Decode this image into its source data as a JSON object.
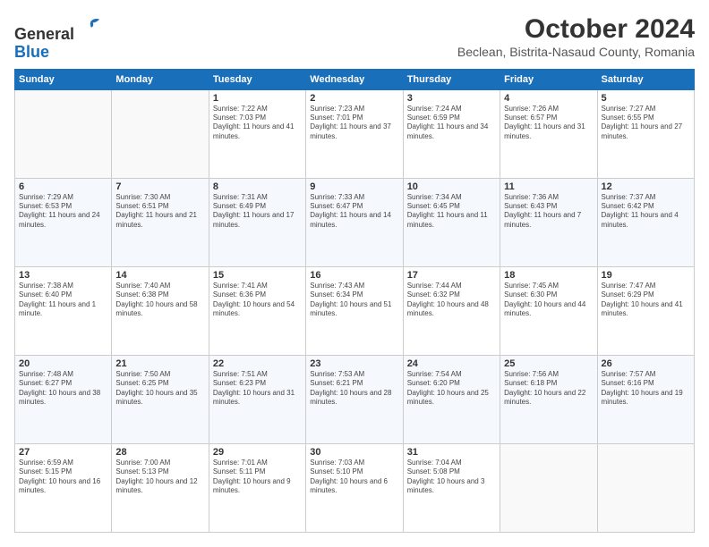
{
  "header": {
    "logo_line1": "General",
    "logo_line2": "Blue",
    "month": "October 2024",
    "location": "Beclean, Bistrita-Nasaud County, Romania"
  },
  "days_of_week": [
    "Sunday",
    "Monday",
    "Tuesday",
    "Wednesday",
    "Thursday",
    "Friday",
    "Saturday"
  ],
  "weeks": [
    [
      {
        "day": "",
        "info": ""
      },
      {
        "day": "",
        "info": ""
      },
      {
        "day": "1",
        "info": "Sunrise: 7:22 AM\nSunset: 7:03 PM\nDaylight: 11 hours and 41 minutes."
      },
      {
        "day": "2",
        "info": "Sunrise: 7:23 AM\nSunset: 7:01 PM\nDaylight: 11 hours and 37 minutes."
      },
      {
        "day": "3",
        "info": "Sunrise: 7:24 AM\nSunset: 6:59 PM\nDaylight: 11 hours and 34 minutes."
      },
      {
        "day": "4",
        "info": "Sunrise: 7:26 AM\nSunset: 6:57 PM\nDaylight: 11 hours and 31 minutes."
      },
      {
        "day": "5",
        "info": "Sunrise: 7:27 AM\nSunset: 6:55 PM\nDaylight: 11 hours and 27 minutes."
      }
    ],
    [
      {
        "day": "6",
        "info": "Sunrise: 7:29 AM\nSunset: 6:53 PM\nDaylight: 11 hours and 24 minutes."
      },
      {
        "day": "7",
        "info": "Sunrise: 7:30 AM\nSunset: 6:51 PM\nDaylight: 11 hours and 21 minutes."
      },
      {
        "day": "8",
        "info": "Sunrise: 7:31 AM\nSunset: 6:49 PM\nDaylight: 11 hours and 17 minutes."
      },
      {
        "day": "9",
        "info": "Sunrise: 7:33 AM\nSunset: 6:47 PM\nDaylight: 11 hours and 14 minutes."
      },
      {
        "day": "10",
        "info": "Sunrise: 7:34 AM\nSunset: 6:45 PM\nDaylight: 11 hours and 11 minutes."
      },
      {
        "day": "11",
        "info": "Sunrise: 7:36 AM\nSunset: 6:43 PM\nDaylight: 11 hours and 7 minutes."
      },
      {
        "day": "12",
        "info": "Sunrise: 7:37 AM\nSunset: 6:42 PM\nDaylight: 11 hours and 4 minutes."
      }
    ],
    [
      {
        "day": "13",
        "info": "Sunrise: 7:38 AM\nSunset: 6:40 PM\nDaylight: 11 hours and 1 minute."
      },
      {
        "day": "14",
        "info": "Sunrise: 7:40 AM\nSunset: 6:38 PM\nDaylight: 10 hours and 58 minutes."
      },
      {
        "day": "15",
        "info": "Sunrise: 7:41 AM\nSunset: 6:36 PM\nDaylight: 10 hours and 54 minutes."
      },
      {
        "day": "16",
        "info": "Sunrise: 7:43 AM\nSunset: 6:34 PM\nDaylight: 10 hours and 51 minutes."
      },
      {
        "day": "17",
        "info": "Sunrise: 7:44 AM\nSunset: 6:32 PM\nDaylight: 10 hours and 48 minutes."
      },
      {
        "day": "18",
        "info": "Sunrise: 7:45 AM\nSunset: 6:30 PM\nDaylight: 10 hours and 44 minutes."
      },
      {
        "day": "19",
        "info": "Sunrise: 7:47 AM\nSunset: 6:29 PM\nDaylight: 10 hours and 41 minutes."
      }
    ],
    [
      {
        "day": "20",
        "info": "Sunrise: 7:48 AM\nSunset: 6:27 PM\nDaylight: 10 hours and 38 minutes."
      },
      {
        "day": "21",
        "info": "Sunrise: 7:50 AM\nSunset: 6:25 PM\nDaylight: 10 hours and 35 minutes."
      },
      {
        "day": "22",
        "info": "Sunrise: 7:51 AM\nSunset: 6:23 PM\nDaylight: 10 hours and 31 minutes."
      },
      {
        "day": "23",
        "info": "Sunrise: 7:53 AM\nSunset: 6:21 PM\nDaylight: 10 hours and 28 minutes."
      },
      {
        "day": "24",
        "info": "Sunrise: 7:54 AM\nSunset: 6:20 PM\nDaylight: 10 hours and 25 minutes."
      },
      {
        "day": "25",
        "info": "Sunrise: 7:56 AM\nSunset: 6:18 PM\nDaylight: 10 hours and 22 minutes."
      },
      {
        "day": "26",
        "info": "Sunrise: 7:57 AM\nSunset: 6:16 PM\nDaylight: 10 hours and 19 minutes."
      }
    ],
    [
      {
        "day": "27",
        "info": "Sunrise: 6:59 AM\nSunset: 5:15 PM\nDaylight: 10 hours and 16 minutes."
      },
      {
        "day": "28",
        "info": "Sunrise: 7:00 AM\nSunset: 5:13 PM\nDaylight: 10 hours and 12 minutes."
      },
      {
        "day": "29",
        "info": "Sunrise: 7:01 AM\nSunset: 5:11 PM\nDaylight: 10 hours and 9 minutes."
      },
      {
        "day": "30",
        "info": "Sunrise: 7:03 AM\nSunset: 5:10 PM\nDaylight: 10 hours and 6 minutes."
      },
      {
        "day": "31",
        "info": "Sunrise: 7:04 AM\nSunset: 5:08 PM\nDaylight: 10 hours and 3 minutes."
      },
      {
        "day": "",
        "info": ""
      },
      {
        "day": "",
        "info": ""
      }
    ]
  ]
}
